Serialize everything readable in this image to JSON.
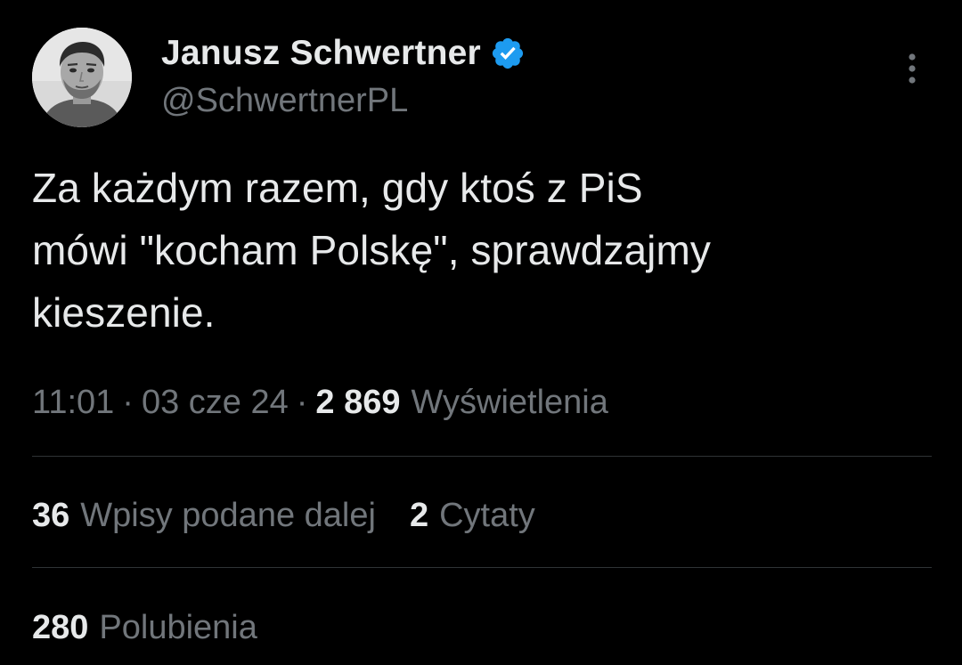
{
  "author": {
    "display_name": "Janusz Schwertner",
    "handle": "@SchwertnerPL",
    "verified": true,
    "verified_color": "#1d9bf0"
  },
  "tweet": {
    "text": "Za każdym razem, gdy ktoś z PiS\nmówi \"kocham Polskę\", sprawdzajmy\nkieszenie.",
    "time": "11:01",
    "date": "03 cze 24",
    "separator": "·",
    "views_count": "2 869",
    "views_label": "Wyświetlenia"
  },
  "stats": {
    "retweets_count": "36",
    "retweets_label": "Wpisy podane dalej",
    "quotes_count": "2",
    "quotes_label": "Cytaty",
    "likes_count": "280",
    "likes_label": "Polubienia"
  },
  "icons": {
    "more": "more-vertical-icon",
    "verified": "verified-badge-icon",
    "avatar": "avatar"
  },
  "colors": {
    "background": "#000000",
    "primary_text": "#e7e9ea",
    "secondary_text": "#71767b",
    "divider": "#2f3336"
  }
}
